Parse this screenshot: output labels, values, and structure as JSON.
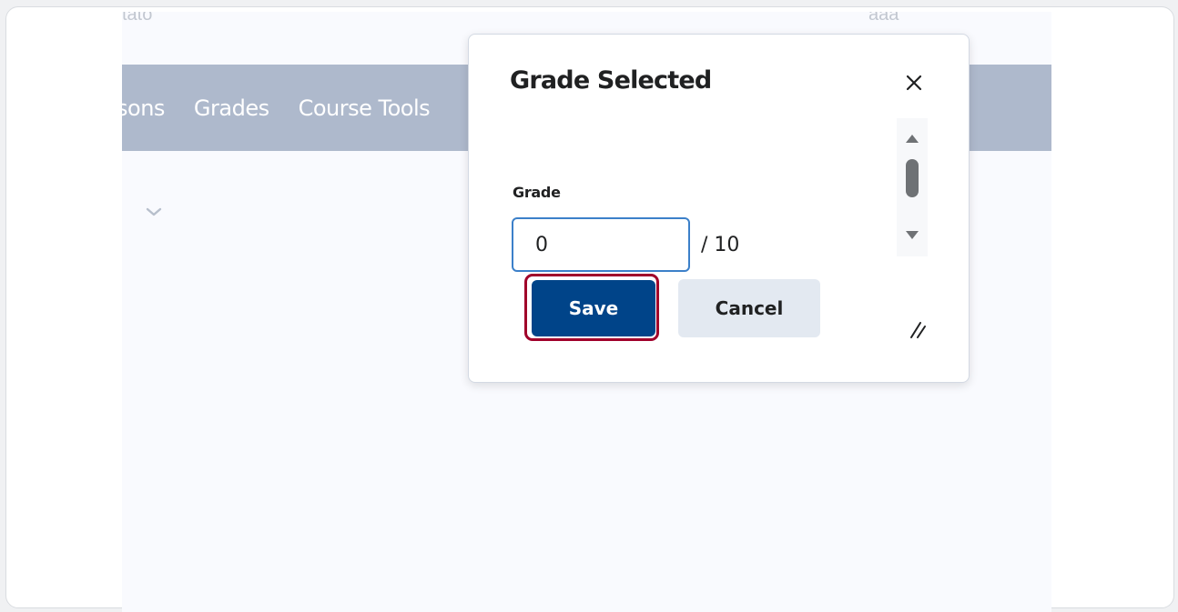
{
  "background": {
    "crumb_left": "tato",
    "crumb_right": "aaa",
    "nav_items": [
      "sons",
      "Grades",
      "Course Tools"
    ]
  },
  "dialog": {
    "title": "Grade Selected",
    "grade_label": "Grade",
    "grade_value": "0",
    "grade_out_of": "/ 10",
    "save_label": "Save",
    "cancel_label": "Cancel"
  },
  "colors": {
    "primary": "#004489",
    "highlight": "#a0002a",
    "navbar": "#aeb9cc",
    "input_focus": "#3c80c9"
  },
  "icons": {
    "close": "close-icon",
    "chevron": "chevron-down-icon",
    "resize": "resize-handle-icon"
  }
}
